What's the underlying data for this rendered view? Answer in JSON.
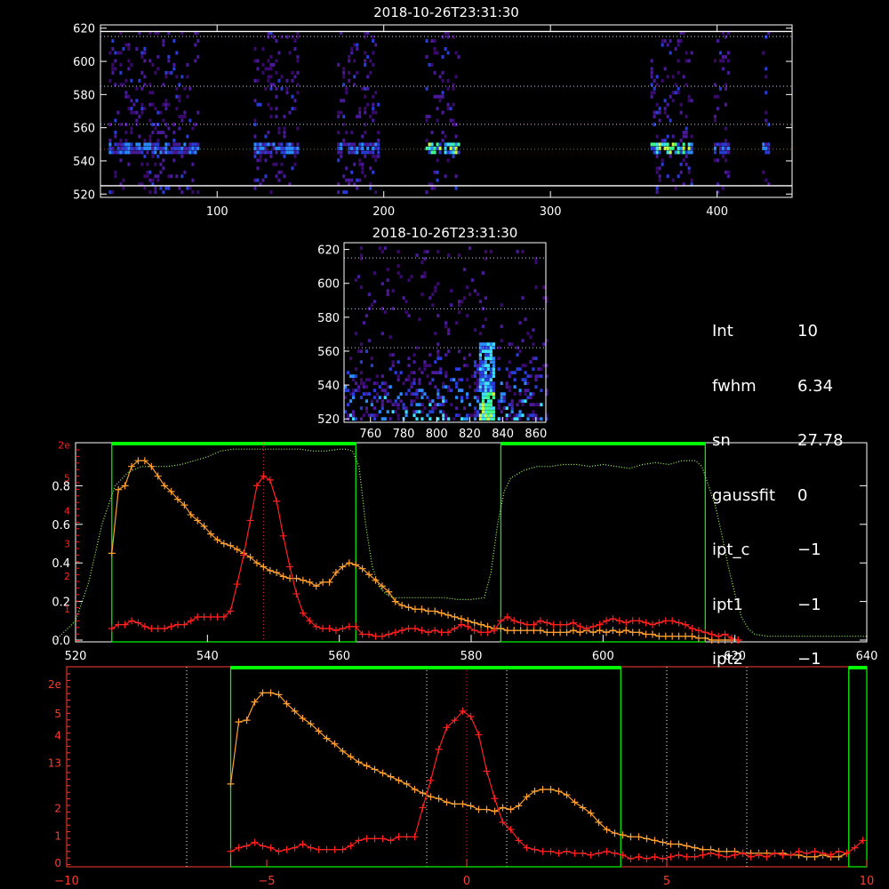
{
  "colors": {
    "background": "#000000",
    "axis": "#ffffff",
    "bottom_axis": "#ff3b30",
    "green_filter": "#00ff00",
    "orange_series": "#ffa030",
    "red_series": "#ff2020",
    "guide_green": "#a0ff60",
    "guide_red": "#ff3030",
    "ref_white": "#ffffff"
  },
  "info": {
    "rows": [
      {
        "key": "Int",
        "value": "10"
      },
      {
        "key": "fwhm",
        "value": "6.34"
      },
      {
        "key": "sn",
        "value": "27.78"
      },
      {
        "key": "gaussfit",
        "value": "0"
      },
      {
        "key": "ipt_c",
        "value": "−1"
      },
      {
        "key": "ipt1",
        "value": "−1"
      },
      {
        "key": "ipt2",
        "value": "−1"
      }
    ]
  },
  "chart_data": [
    {
      "type": "heatmap",
      "title": "2018-10-26T23:31:30",
      "xlim": [
        30,
        445
      ],
      "ylim": [
        518,
        622
      ],
      "xticks": [
        100,
        200,
        300,
        400
      ],
      "yticks": [
        520,
        540,
        560,
        580,
        600,
        620
      ],
      "emission_line": 547,
      "guides_green": [
        562,
        585,
        615
      ],
      "guides_white": [
        525,
        618
      ],
      "strips": [
        [
          35,
          88
        ],
        [
          122,
          148
        ],
        [
          172,
          196
        ],
        [
          225,
          245
        ],
        [
          360,
          385
        ],
        [
          398,
          407
        ],
        [
          427,
          431
        ]
      ],
      "bright_strips": [
        [
          225,
          245
        ],
        [
          360,
          385
        ]
      ]
    },
    {
      "type": "heatmap",
      "title": "2018-10-26T23:31:30",
      "xlim": [
        744,
        866
      ],
      "ylim": [
        518,
        624
      ],
      "xticks": [
        760,
        780,
        800,
        820,
        840,
        860
      ],
      "yticks": [
        520,
        540,
        560,
        580,
        600,
        620
      ],
      "guides_green": [
        562,
        585,
        615
      ],
      "hot_column": 830
    },
    {
      "type": "line",
      "xlim": [
        520,
        640
      ],
      "xticks": [
        520,
        540,
        560,
        580,
        600,
        620,
        640
      ],
      "ylim": [
        0,
        1
      ],
      "yticks_left": [
        "0.0",
        "0.2",
        "0.4",
        "0.6",
        "0.8"
      ],
      "yticks_red": [
        "1",
        "2",
        "3",
        "4",
        "5",
        "2e"
      ],
      "line_center": 548.5,
      "filter_boxes": [
        [
          525.5,
          562.5
        ],
        [
          584.5,
          615.5
        ]
      ],
      "series": [
        {
          "color": "orange",
          "x": [
            525.5,
            526.5,
            527.5,
            528.5,
            529.5,
            530.5,
            531.5,
            532.5,
            533.5,
            534.5,
            535.5,
            536.5,
            537.5,
            538.5,
            539.5,
            540.5,
            541.5,
            542.5,
            543.5,
            544.5,
            545.5,
            546.5,
            547.5,
            548.5,
            549.5,
            550.5,
            551.5,
            552.5,
            553.5,
            554.5,
            555.5,
            556.5,
            557.5,
            558.5,
            559.5,
            560.5,
            561.5,
            562.5,
            563.5,
            564.5,
            565.5,
            566.5,
            567.5,
            568.5,
            569.5,
            570.5,
            571.5,
            572.5,
            573.5,
            574.5,
            575.5,
            576.5,
            577.5,
            578.5,
            579.5,
            580.5,
            581.5,
            582.5,
            583.5,
            584.5,
            585.5,
            586.5,
            587.5,
            588.5,
            589.5,
            590.5,
            591.5,
            592.5,
            593.5,
            594.5,
            595.5,
            596.5,
            597.5,
            598.5,
            599.5,
            600.5,
            601.5,
            602.5,
            603.5,
            604.5,
            605.5,
            606.5,
            607.5,
            608.5,
            609.5,
            610.5,
            611.5,
            612.5,
            613.5,
            614.5,
            615.5,
            616.5,
            617.5,
            618.5,
            619.5,
            620.5
          ],
          "y": [
            0.45,
            0.78,
            0.8,
            0.9,
            0.93,
            0.93,
            0.9,
            0.85,
            0.8,
            0.77,
            0.73,
            0.7,
            0.65,
            0.62,
            0.59,
            0.55,
            0.52,
            0.5,
            0.49,
            0.47,
            0.45,
            0.43,
            0.4,
            0.38,
            0.36,
            0.35,
            0.33,
            0.32,
            0.32,
            0.31,
            0.3,
            0.28,
            0.3,
            0.3,
            0.35,
            0.38,
            0.4,
            0.39,
            0.37,
            0.34,
            0.31,
            0.28,
            0.25,
            0.2,
            0.18,
            0.17,
            0.16,
            0.16,
            0.15,
            0.15,
            0.14,
            0.13,
            0.12,
            0.11,
            0.1,
            0.09,
            0.08,
            0.07,
            0.06,
            0.06,
            0.05,
            0.05,
            0.05,
            0.05,
            0.05,
            0.05,
            0.04,
            0.04,
            0.04,
            0.04,
            0.05,
            0.04,
            0.05,
            0.04,
            0.05,
            0.04,
            0.05,
            0.04,
            0.05,
            0.04,
            0.04,
            0.03,
            0.03,
            0.02,
            0.02,
            0.02,
            0.02,
            0.02,
            0.02,
            0.01,
            0.01,
            0.0,
            0.0,
            0.0,
            0.0,
            0.0
          ]
        },
        {
          "color": "red",
          "x": [
            525.5,
            526.5,
            527.5,
            528.5,
            529.5,
            530.5,
            531.5,
            532.5,
            533.5,
            534.5,
            535.5,
            536.5,
            537.5,
            538.5,
            539.5,
            540.5,
            541.5,
            542.5,
            543.5,
            544.5,
            545.5,
            546.5,
            547.5,
            548.5,
            549.5,
            550.5,
            551.5,
            552.5,
            553.5,
            554.5,
            555.5,
            556.5,
            557.5,
            558.5,
            559.5,
            560.5,
            561.5,
            562.5,
            563.5,
            564.5,
            565.5,
            566.5,
            567.5,
            568.5,
            569.5,
            570.5,
            571.5,
            572.5,
            573.5,
            574.5,
            575.5,
            576.5,
            577.5,
            578.5,
            579.5,
            580.5,
            581.5,
            582.5,
            583.5,
            584.5,
            585.5,
            586.5,
            587.5,
            588.5,
            589.5,
            590.5,
            591.5,
            592.5,
            593.5,
            594.5,
            595.5,
            596.5,
            597.5,
            598.5,
            599.5,
            600.5,
            601.5,
            602.5,
            603.5,
            604.5,
            605.5,
            606.5,
            607.5,
            608.5,
            609.5,
            610.5,
            611.5,
            612.5,
            613.5,
            614.5,
            615.5,
            616.5,
            617.5,
            618.5,
            619.5,
            620.5
          ],
          "y": [
            0.06,
            0.08,
            0.08,
            0.1,
            0.09,
            0.07,
            0.06,
            0.06,
            0.06,
            0.07,
            0.08,
            0.08,
            0.1,
            0.12,
            0.12,
            0.12,
            0.12,
            0.12,
            0.15,
            0.29,
            0.44,
            0.62,
            0.8,
            0.85,
            0.83,
            0.72,
            0.54,
            0.38,
            0.24,
            0.14,
            0.1,
            0.07,
            0.06,
            0.06,
            0.05,
            0.06,
            0.07,
            0.07,
            0.03,
            0.03,
            0.02,
            0.02,
            0.03,
            0.04,
            0.05,
            0.06,
            0.06,
            0.05,
            0.04,
            0.05,
            0.04,
            0.04,
            0.06,
            0.08,
            0.07,
            0.05,
            0.04,
            0.04,
            0.05,
            0.1,
            0.12,
            0.1,
            0.09,
            0.08,
            0.08,
            0.1,
            0.09,
            0.08,
            0.08,
            0.08,
            0.09,
            0.07,
            0.06,
            0.07,
            0.08,
            0.1,
            0.11,
            0.1,
            0.09,
            0.1,
            0.1,
            0.09,
            0.08,
            0.09,
            0.1,
            0.1,
            0.09,
            0.08,
            0.06,
            0.05,
            0.04,
            0.03,
            0.02,
            0.03,
            0.01,
            0.0
          ]
        },
        {
          "color": "green-dotted",
          "x": [
            517,
            520,
            522,
            524,
            526,
            528,
            530,
            532,
            534,
            536,
            538,
            540,
            542,
            544,
            546,
            548,
            550,
            552,
            554,
            556,
            558,
            560,
            561,
            562,
            563,
            564,
            565,
            566,
            567,
            568,
            570,
            572,
            574,
            576,
            578,
            580,
            582,
            583,
            584,
            585,
            586,
            588,
            590,
            592,
            594,
            596,
            598,
            600,
            602,
            604,
            606,
            608,
            610,
            612,
            614,
            615,
            616,
            617,
            618,
            619,
            620,
            621,
            622,
            623,
            625,
            628,
            632,
            636,
            640
          ],
          "y": [
            0.0,
            0.1,
            0.3,
            0.6,
            0.8,
            0.87,
            0.9,
            0.9,
            0.9,
            0.91,
            0.93,
            0.95,
            0.98,
            0.99,
            0.99,
            0.99,
            0.99,
            0.99,
            0.99,
            0.98,
            0.98,
            0.99,
            0.99,
            0.98,
            0.9,
            0.6,
            0.38,
            0.28,
            0.24,
            0.22,
            0.22,
            0.22,
            0.22,
            0.22,
            0.21,
            0.21,
            0.22,
            0.35,
            0.6,
            0.77,
            0.84,
            0.88,
            0.9,
            0.9,
            0.91,
            0.91,
            0.9,
            0.91,
            0.9,
            0.89,
            0.91,
            0.92,
            0.91,
            0.93,
            0.93,
            0.9,
            0.8,
            0.7,
            0.55,
            0.38,
            0.24,
            0.12,
            0.06,
            0.03,
            0.02,
            0.02,
            0.02,
            0.02,
            0.02
          ]
        }
      ]
    },
    {
      "type": "line",
      "xlim": [
        -10,
        10
      ],
      "xticks": [
        -10,
        -5,
        0,
        5,
        10
      ],
      "ylim": [
        0,
        1
      ],
      "yticks_red": [
        "0",
        "1",
        "2",
        "13",
        "4",
        "5",
        "2e"
      ],
      "filter_box": [
        -5.9,
        3.85
      ],
      "edge_box": [
        9.55,
        10
      ],
      "guides_white": [
        -7.0,
        -1.0,
        1.0,
        5.0,
        7.0
      ],
      "line_center": 0,
      "series": [
        {
          "color": "orange",
          "x": [
            -5.9,
            -5.7,
            -5.5,
            -5.3,
            -5.1,
            -4.9,
            -4.7,
            -4.5,
            -4.3,
            -4.1,
            -3.9,
            -3.7,
            -3.5,
            -3.3,
            -3.1,
            -2.9,
            -2.7,
            -2.5,
            -2.3,
            -2.1,
            -1.9,
            -1.7,
            -1.5,
            -1.3,
            -1.1,
            -0.9,
            -0.7,
            -0.5,
            -0.3,
            -0.1,
            0.1,
            0.3,
            0.5,
            0.7,
            0.9,
            1.1,
            1.3,
            1.5,
            1.7,
            1.9,
            2.1,
            2.3,
            2.5,
            2.7,
            2.9,
            3.1,
            3.3,
            3.5,
            3.7,
            3.9,
            4.1,
            4.3,
            4.5,
            4.7,
            4.9,
            5.1,
            5.3,
            5.5,
            5.7,
            5.9,
            6.1,
            6.3,
            6.5,
            6.7,
            6.9,
            7.1,
            7.3,
            7.5,
            7.7,
            7.9,
            8.1,
            8.3,
            8.5,
            8.7,
            8.9,
            9.1,
            9.3,
            9.5
          ],
          "y": [
            0.43,
            0.77,
            0.78,
            0.88,
            0.93,
            0.93,
            0.92,
            0.87,
            0.83,
            0.79,
            0.76,
            0.72,
            0.68,
            0.65,
            0.61,
            0.58,
            0.55,
            0.53,
            0.51,
            0.49,
            0.47,
            0.45,
            0.43,
            0.4,
            0.38,
            0.36,
            0.35,
            0.33,
            0.32,
            0.32,
            0.31,
            0.29,
            0.29,
            0.28,
            0.3,
            0.29,
            0.31,
            0.36,
            0.39,
            0.4,
            0.4,
            0.39,
            0.37,
            0.33,
            0.3,
            0.27,
            0.22,
            0.18,
            0.16,
            0.15,
            0.14,
            0.14,
            0.13,
            0.12,
            0.11,
            0.1,
            0.1,
            0.09,
            0.08,
            0.07,
            0.07,
            0.06,
            0.06,
            0.06,
            0.05,
            0.05,
            0.05,
            0.05,
            0.05,
            0.05,
            0.04,
            0.04,
            0.03,
            0.03,
            0.04,
            0.03,
            0.03,
            0.05
          ]
        },
        {
          "color": "red",
          "x": [
            -5.9,
            -5.7,
            -5.5,
            -5.3,
            -5.1,
            -4.9,
            -4.7,
            -4.5,
            -4.3,
            -4.1,
            -3.9,
            -3.7,
            -3.5,
            -3.3,
            -3.1,
            -2.9,
            -2.7,
            -2.5,
            -2.3,
            -2.1,
            -1.9,
            -1.7,
            -1.5,
            -1.3,
            -1.1,
            -0.9,
            -0.7,
            -0.5,
            -0.3,
            -0.1,
            0.1,
            0.3,
            0.5,
            0.7,
            0.9,
            1.1,
            1.3,
            1.5,
            1.7,
            1.9,
            2.1,
            2.3,
            2.5,
            2.7,
            2.9,
            3.1,
            3.3,
            3.5,
            3.7,
            3.9,
            4.1,
            4.3,
            4.5,
            4.7,
            4.9,
            5.1,
            5.3,
            5.5,
            5.7,
            5.9,
            6.1,
            6.3,
            6.5,
            6.7,
            6.9,
            7.1,
            7.3,
            7.5,
            7.7,
            7.9,
            8.1,
            8.3,
            8.5,
            8.7,
            8.9,
            9.1,
            9.3,
            9.5,
            9.7,
            9.9
          ],
          "y": [
            0.06,
            0.08,
            0.09,
            0.11,
            0.09,
            0.08,
            0.06,
            0.07,
            0.08,
            0.1,
            0.08,
            0.07,
            0.07,
            0.07,
            0.07,
            0.09,
            0.12,
            0.13,
            0.13,
            0.13,
            0.12,
            0.14,
            0.14,
            0.14,
            0.3,
            0.45,
            0.62,
            0.74,
            0.78,
            0.83,
            0.8,
            0.7,
            0.5,
            0.35,
            0.22,
            0.18,
            0.12,
            0.08,
            0.07,
            0.06,
            0.06,
            0.05,
            0.06,
            0.05,
            0.05,
            0.04,
            0.05,
            0.06,
            0.05,
            0.04,
            0.02,
            0.03,
            0.02,
            0.03,
            0.02,
            0.03,
            0.04,
            0.03,
            0.03,
            0.04,
            0.05,
            0.04,
            0.03,
            0.04,
            0.05,
            0.03,
            0.04,
            0.03,
            0.05,
            0.04,
            0.04,
            0.06,
            0.05,
            0.06,
            0.05,
            0.04,
            0.06,
            0.05,
            0.08,
            0.12
          ]
        }
      ]
    }
  ]
}
